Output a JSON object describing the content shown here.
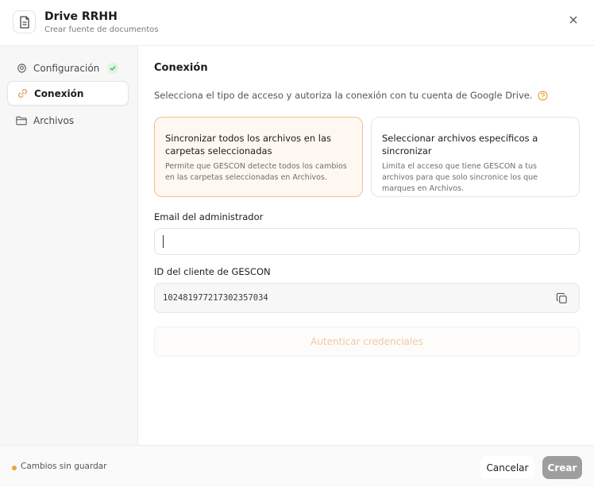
{
  "header": {
    "title": "Drive RRHH",
    "subtitle": "Crear fuente de documentos",
    "icon": "document-icon",
    "close_icon": "close-icon"
  },
  "sidebar": {
    "items": [
      {
        "label": "Configuración",
        "icon": "gear-icon",
        "completed": true
      },
      {
        "label": "Conexión",
        "icon": "link-icon",
        "active": true
      },
      {
        "label": "Archivos",
        "icon": "folder-icon"
      }
    ]
  },
  "main": {
    "section_title": "Conexión",
    "description": "Selecciona el tipo de acceso y autoriza la conexión con tu cuenta de Google Drive.",
    "options": [
      {
        "title": "Sincronizar todos los archivos en las carpetas seleccionadas",
        "description": "Permite que GESCON detecte todos los cambios en las carpetas seleccionadas en Archivos.",
        "selected": true
      },
      {
        "title": "Seleccionar archivos específicos a sincronizar",
        "description": "Limita el acceso que tiene GESCON a tus archivos para que solo sincronice los que marques en Archivos.",
        "selected": false
      }
    ],
    "email_label": "Email del administrador",
    "email_value": "",
    "client_id_label": "ID del cliente de GESCON",
    "client_id_value": "102481977217302357034",
    "auth_button_label": "Autenticar credenciales"
  },
  "footer": {
    "unsaved_text": "Cambios sin guardar",
    "cancel_label": "Cancelar",
    "create_label": "Crear"
  },
  "colors": {
    "accent": "#f0a13a",
    "success": "#3bb35a",
    "disabled_button": "#9e9e9e"
  }
}
